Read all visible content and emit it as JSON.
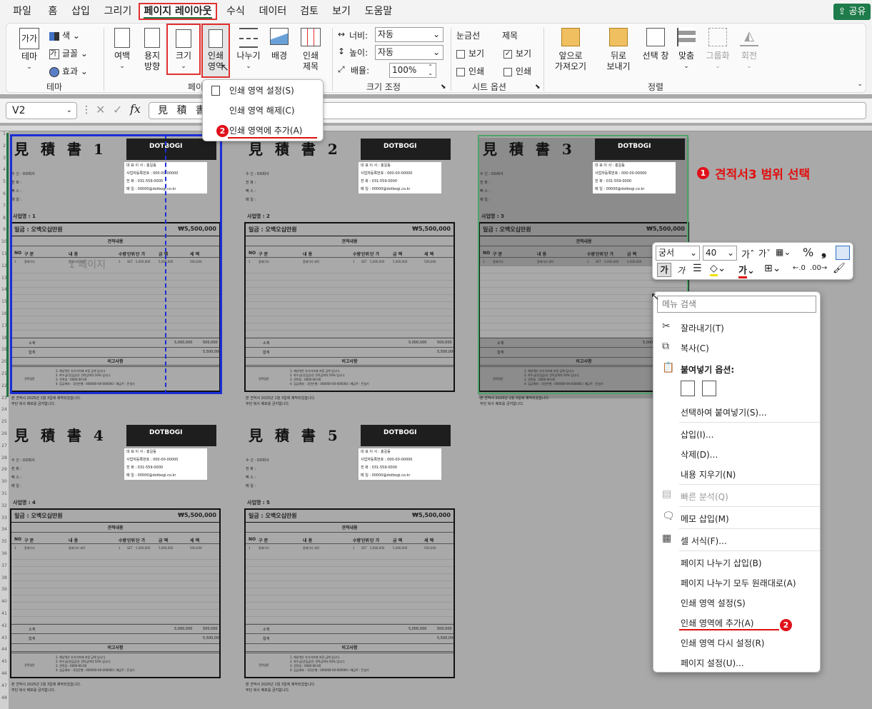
{
  "menu_tabs": [
    "파일",
    "홈",
    "삽입",
    "그리기",
    "페이지 레이아웃",
    "수식",
    "데이터",
    "검토",
    "보기",
    "도움말"
  ],
  "share_label": "공유",
  "ribbon": {
    "theme": {
      "btn": "테마",
      "colors": "색",
      "fonts": "글꼴",
      "effects": "효과",
      "group": "테마"
    },
    "margins": "여백",
    "orientation_1": "용지",
    "orientation_2": "방향",
    "size": "크기",
    "print_area_1": "인쇄",
    "print_area_2": "영역",
    "breaks": "나누기",
    "background": "배경",
    "print_titles_1": "인쇄",
    "print_titles_2": "제목",
    "pagesetup_group": "페이지 설정",
    "scale": {
      "width_label": "너비:",
      "width_val": "자동",
      "height_label": "높이:",
      "height_val": "자동",
      "scale_label": "배율:",
      "scale_val": "100%",
      "group": "크기 조정"
    },
    "sheet_opts": {
      "grid": "눈금선",
      "head": "제목",
      "view": "보기",
      "print": "인쇄",
      "group": "시트 옵션"
    },
    "arrange": {
      "forward_1": "앞으로",
      "forward_2": "가져오기",
      "back_1": "뒤로",
      "back_2": "보내기",
      "pane": "선택 창",
      "align": "맞춤",
      "group_btn": "그룹화",
      "rotate": "회전",
      "group": "정렬"
    }
  },
  "namebox": "V2",
  "formula": "見 積 書",
  "print_menu": [
    "인쇄 영역 설정(S)",
    "인쇄 영역 해제(C)",
    "인쇄 영역에 추가(A)"
  ],
  "annotations": {
    "n1": "1",
    "n2": "2",
    "select_label": "견적서3 범위 선택"
  },
  "page_watermark": "1 페이지",
  "quotes": [
    {
      "title": "見 積 書 1",
      "project": "사업명 : 1"
    },
    {
      "title": "見 積 書 2",
      "project": "사업명 : 2"
    },
    {
      "title": "見 積 書 3",
      "project": "사업명 : 3"
    },
    {
      "title": "見 積 書 4",
      "project": "사업명 : 4"
    },
    {
      "title": "見 積 書 5",
      "project": "사업명 : 5"
    }
  ],
  "quote_common": {
    "logo": "DOTBOGI",
    "logo_sub": "E-business Best Partner  (http://www.dotbogi.co.kr)",
    "to_lines": [
      "수 신 : OO회사",
      "전 화 :",
      "팩 스 :",
      "메 일 :"
    ],
    "from_lines": [
      "대 표 이 사 : 홍길동",
      "사업자등록번호 : 000-00-00000",
      "전 화 : 031-559-0000",
      "메 일 : 00000@dotbogi.co.kr"
    ],
    "amount_label": "일금 : 오백오십만원",
    "amount": "₩5,500,000",
    "detail_header": "견적내용",
    "cols": [
      "NO",
      "구 분",
      "내 용",
      "수량",
      "단위",
      "단 가",
      "금 액",
      "세 액"
    ],
    "row1": [
      "1",
      "홈페이지",
      "홈페이지 제작",
      "1",
      "SET",
      "5,000,000",
      "5,000,000",
      "500,000"
    ],
    "subtotal_label": "소계",
    "subtotal": "5,000,000",
    "subtotal_tax": "500,000",
    "total_label": "합계",
    "total": "5,500,000",
    "remark_header": "비고사항",
    "remark_label": "견적일문",
    "remarks": [
      "1. 해상역은 추가기자재 포함 금액 입니다.",
      "2. 착수금(선입금)은 견적금액의 50% 입니다.",
      "3. 견적일 : 0000-00-00",
      "4. 입금계좌 : 국민은행 : 000000-00-000000 / 예금주 : 돈실기"
    ],
    "footer": [
      "본 견적서 2025년 1월 3일에 제작되었습니다.",
      "무단 복사 배포를 금지합니다."
    ]
  },
  "mini_toolbar": {
    "font": "궁서",
    "size": "40"
  },
  "context_menu": {
    "search_placeholder": "메뉴 검색",
    "items": [
      "잘라내기(T)",
      "복사(C)",
      "붙여넣기 옵션:",
      "선택하여 붙여넣기(S)...",
      "삽입(I)...",
      "삭제(D)...",
      "내용 지우기(N)",
      "빠른 분석(Q)",
      "메모 삽입(M)",
      "셀 서식(F)...",
      "페이지 나누기 삽입(B)",
      "페이지 나누기 모두 원래대로(A)",
      "인쇄 영역 설정(S)",
      "인쇄 영역에 추가(A)",
      "인쇄 영역 다시 설정(R)",
      "페이지 설정(U)..."
    ]
  },
  "row_numbers": [
    "1",
    "2",
    "3",
    "4",
    "5",
    "6",
    "7",
    "8",
    "9",
    "10",
    "11",
    "12",
    "13",
    "14",
    "15",
    "16",
    "17",
    "18",
    "19",
    "20",
    "21",
    "22",
    "23",
    "24",
    "25",
    "26",
    "27",
    "28",
    "29",
    "30",
    "31",
    "32",
    "33",
    "34",
    "35",
    "36",
    "37",
    "38",
    "39",
    "40",
    "41",
    "42",
    "43",
    "44",
    "45",
    "46",
    "47",
    "48"
  ]
}
